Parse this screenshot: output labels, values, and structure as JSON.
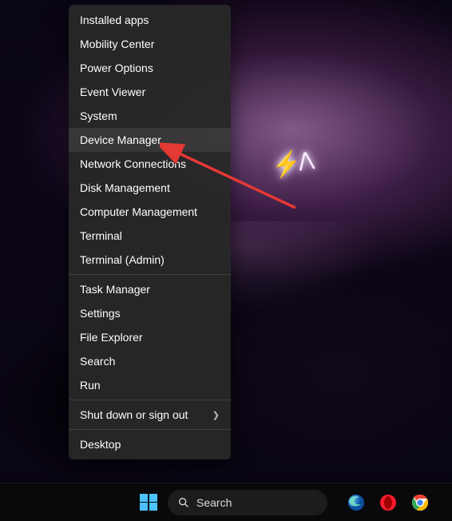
{
  "menu": {
    "group1": [
      "Installed apps",
      "Mobility Center",
      "Power Options",
      "Event Viewer",
      "System",
      "Device Manager",
      "Network Connections",
      "Disk Management",
      "Computer Management",
      "Terminal",
      "Terminal (Admin)"
    ],
    "group2": [
      "Task Manager",
      "Settings",
      "File Explorer",
      "Search",
      "Run"
    ],
    "group3": [
      "Shut down or sign out"
    ],
    "group4": [
      "Desktop"
    ],
    "highlighted_index": 5
  },
  "taskbar": {
    "search_placeholder": "Search"
  }
}
